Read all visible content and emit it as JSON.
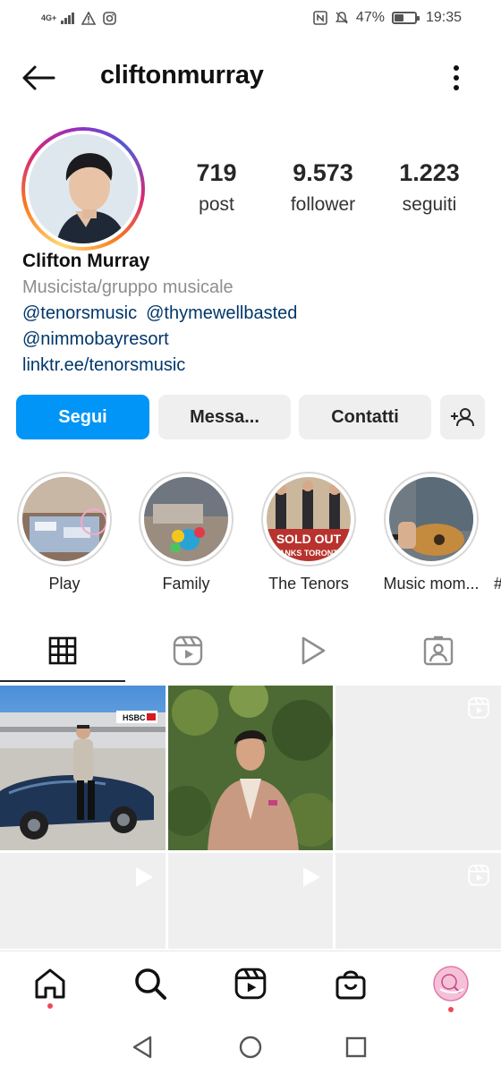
{
  "status_bar": {
    "network": "4G+",
    "battery_percent": "47%",
    "battery_level": 0.47,
    "time": "19:35",
    "icons": [
      "signal-icon",
      "warning-icon",
      "instagram-icon",
      "nfc-icon",
      "mute-icon",
      "battery-icon"
    ]
  },
  "header": {
    "username": "cliftonmurray",
    "icons": [
      "back-arrow-icon",
      "more-vertical-icon"
    ]
  },
  "profile": {
    "stats": [
      {
        "value": "719",
        "label": "post"
      },
      {
        "value": "9.573",
        "label": "follower"
      },
      {
        "value": "1.223",
        "label": "seguiti"
      }
    ],
    "name": "Clifton Murray",
    "category": "Musicista/gruppo musicale",
    "mentions_line1": [
      "@tenorsmusic",
      "@thymewellbasted"
    ],
    "mentions_line2": "@nimmobayresort",
    "website": "linktr.ee/tenorsmusic"
  },
  "actions": {
    "follow": "Segui",
    "message": "Messa...",
    "contacts": "Contatti",
    "add_user_icon": "add-person-icon"
  },
  "highlights": [
    {
      "label": "Play"
    },
    {
      "label": "Family"
    },
    {
      "label": "The Tenors"
    },
    {
      "label": "Music mom..."
    }
  ],
  "highlight_partial_label": "#",
  "highlight_thumb_text": {
    "tenors_line1": "SOLD OUT",
    "tenors_line2": "HANKS TORONTO"
  },
  "post_text": {
    "hsbc": "HSBC"
  },
  "tabs": [
    "grid-icon",
    "reels-icon",
    "play-icon",
    "tagged-icon"
  ],
  "bottom_nav": [
    "home-icon",
    "search-icon",
    "reels-icon",
    "shop-icon",
    "profile-avatar"
  ],
  "colors": {
    "accent": "#0095f6",
    "notification_dot": "#ed4956",
    "link": "#00376b"
  }
}
